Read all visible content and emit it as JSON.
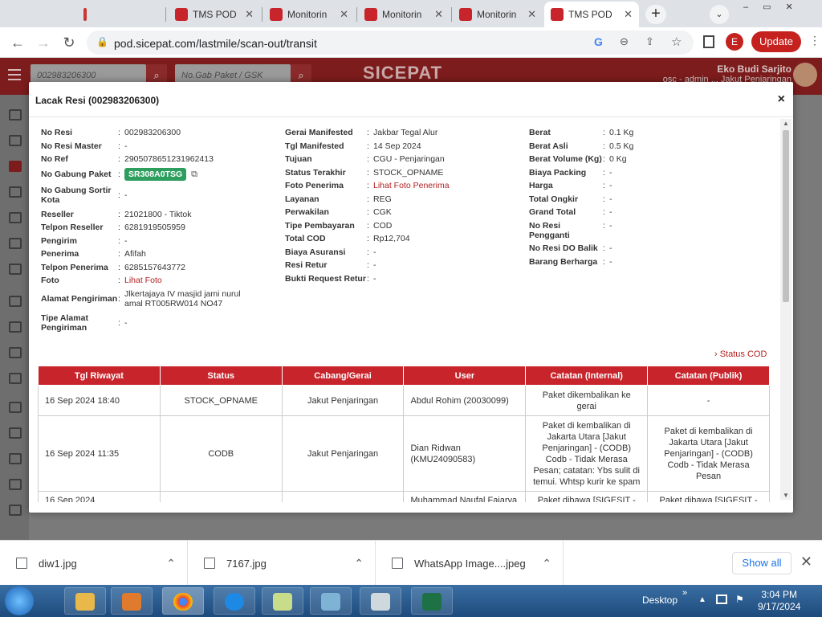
{
  "browser": {
    "tabs": [
      {
        "label": "TMS POD"
      },
      {
        "label": "Monitorin"
      },
      {
        "label": "Monitorin"
      },
      {
        "label": "Monitorin"
      },
      {
        "label": "TMS POD"
      }
    ],
    "url": "pod.sicepat.com/lastmile/scan-out/transit",
    "profile_initial": "E",
    "update_label": "Update",
    "new_tab_label": "+"
  },
  "app": {
    "search1_placeholder": "002983206300",
    "search2_placeholder": "No.Gab Paket / GSK",
    "logo": "SICEPAT",
    "user_name": "Eko Budi Sarjito",
    "user_role": "osc - admin ... Jakut Penjaringan"
  },
  "modal": {
    "title": "Lacak Resi (002983206300)",
    "close": "×",
    "col1": [
      {
        "label": "No Resi",
        "value": "002983206300"
      },
      {
        "label": "No Resi Master",
        "value": "-"
      },
      {
        "label": "No Ref",
        "value": "2905078651231962413"
      },
      {
        "label": "No Gabung Paket",
        "value": "SR308A0TSG"
      },
      {
        "label": "No Gabung Sortir Kota",
        "value": "-"
      },
      {
        "label": "Reseller",
        "value": "21021800 - Tiktok"
      },
      {
        "label": "Telpon Reseller",
        "value": "6281919505959"
      },
      {
        "label": "Pengirim",
        "value": "-"
      },
      {
        "label": "Penerima",
        "value": "Afifah"
      },
      {
        "label": "Telpon Penerima",
        "value": "6285157643772"
      },
      {
        "label": "Foto",
        "value": "Lihat Foto"
      },
      {
        "label": "Alamat Pengiriman",
        "value": "Jlkertajaya IV masjid jami nurul amal RT005RW014 NO47"
      },
      {
        "label": "Tipe Alamat Pengiriman",
        "value": "-"
      }
    ],
    "col2": [
      {
        "label": "Gerai Manifested",
        "value": "Jakbar Tegal Alur"
      },
      {
        "label": "Tgl Manifested",
        "value": "14 Sep 2024"
      },
      {
        "label": "Tujuan",
        "value": "CGU - Penjaringan"
      },
      {
        "label": "Status Terakhir",
        "value": "STOCK_OPNAME"
      },
      {
        "label": "Foto Penerima",
        "value": "Lihat Foto Penerima"
      },
      {
        "label": "Layanan",
        "value": "REG"
      },
      {
        "label": "Perwakilan",
        "value": "CGK"
      },
      {
        "label": "Tipe Pembayaran",
        "value": "COD"
      },
      {
        "label": "Total COD",
        "value": "Rp12,704"
      },
      {
        "label": "Biaya Asuransi",
        "value": "-"
      },
      {
        "label": "Resi Retur",
        "value": "-"
      },
      {
        "label": "Bukti Request Retur",
        "value": "-"
      }
    ],
    "col3": [
      {
        "label": "Berat",
        "value": "0.1 Kg"
      },
      {
        "label": "Berat Asli",
        "value": "0.5 Kg"
      },
      {
        "label": "Berat Volume (Kg)",
        "value": "0 Kg"
      },
      {
        "label": "Biaya Packing",
        "value": "-"
      },
      {
        "label": "Harga",
        "value": "-"
      },
      {
        "label": "Total Ongkir",
        "value": "-"
      },
      {
        "label": "Grand Total",
        "value": "-"
      },
      {
        "label": "No Resi Pengganti",
        "value": "-"
      },
      {
        "label": "No Resi DO Balik",
        "value": "-"
      },
      {
        "label": "Barang Berharga",
        "value": "-"
      }
    ],
    "status_cod": "› Status COD",
    "history_headers": [
      "Tgl Riwayat",
      "Status",
      "Cabang/Gerai",
      "User",
      "Catatan (Internal)",
      "Catatan (Publik)"
    ],
    "history_rows": [
      [
        "16 Sep 2024 18:40",
        "STOCK_OPNAME",
        "Jakut Penjaringan",
        "Abdul Rohim (20030099)",
        "Paket dikembalikan ke gerai",
        "-"
      ],
      [
        "16 Sep 2024 11:35",
        "CODB",
        "Jakut Penjaringan",
        "Dian Ridwan (KMU24090583)",
        "Paket di kembalikan di Jakarta Utara [Jakut Penjaringan] - (CODB) Codb - Tidak Merasa Pesan; catatan: Ybs sulit di temui. Whtsp kurir ke spam",
        "Paket di kembalikan di Jakarta Utara [Jakut Penjaringan] - (CODB) Codb - Tidak Merasa Pesan"
      ],
      [
        "16 Sep 2024",
        "",
        "",
        "Muhammad Naufal Fajarya",
        "Paket dibawa [SIGESIT - Di",
        "Paket dibawa [SIGESIT - Di"
      ]
    ]
  },
  "downloads": {
    "items": [
      {
        "name": "diw1.jpg"
      },
      {
        "name": "7167.jpg"
      },
      {
        "name": "WhatsApp Image....jpeg"
      }
    ],
    "show_all": "Show all"
  },
  "taskbar": {
    "desktop": "Desktop",
    "time": "3:04 PM",
    "date": "9/17/2024"
  }
}
